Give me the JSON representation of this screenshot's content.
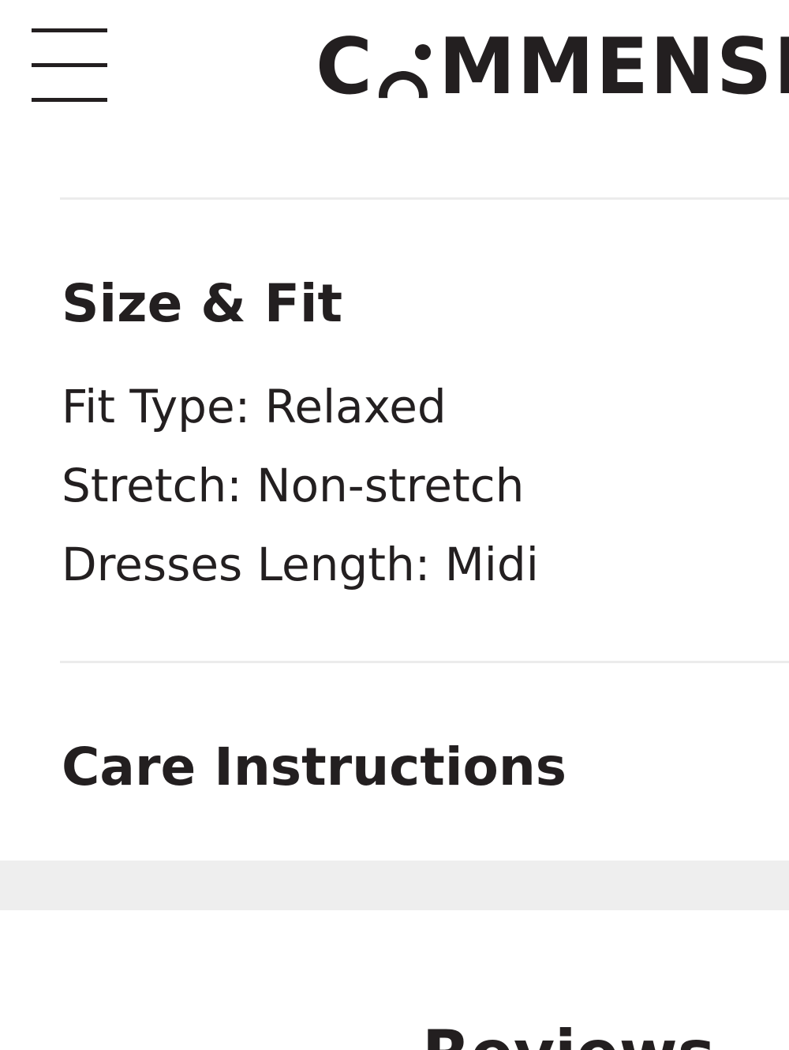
{
  "header": {
    "menu_icon": "hamburger-menu-icon",
    "logo": {
      "before_o": "C",
      "after_o": "MMENSE",
      "full_text": "COMMENSE"
    }
  },
  "size_fit": {
    "title": "Size & Fit",
    "items": [
      "Fit Type: Relaxed",
      "Stretch: Non-stretch",
      "Dresses Length: Midi"
    ]
  },
  "care": {
    "title": "Care Instructions"
  },
  "reviews": {
    "title_visible": "Reviews"
  },
  "colors": {
    "text": "#231f20",
    "divider": "#ececec",
    "band": "#eeeeee",
    "background": "#ffffff"
  }
}
